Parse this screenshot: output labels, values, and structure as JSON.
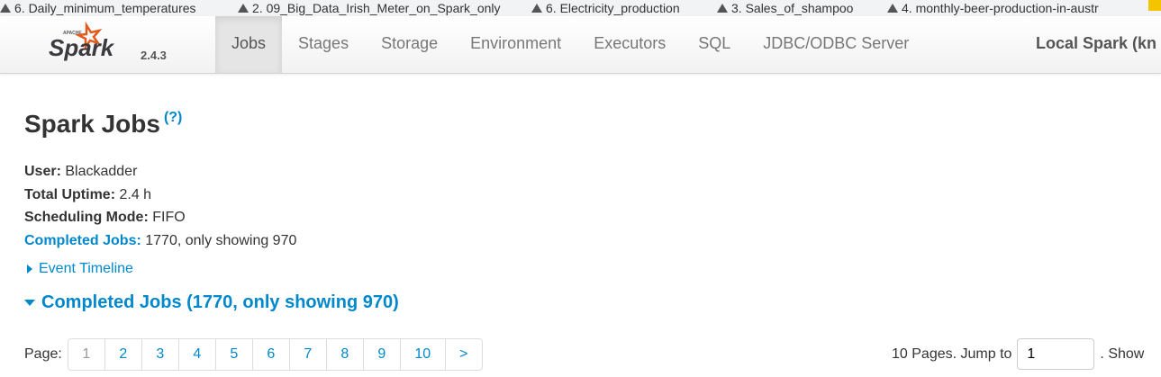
{
  "bookmarks": [
    "6. Daily_minimum_temperatures",
    "2. 09_Big_Data_Irish_Meter_on_Spark_only",
    "6. Electricity_production",
    "3. Sales_of_shampoo",
    "4. monthly-beer-production-in-austr"
  ],
  "navbar": {
    "logo_text": "Apache Spark",
    "version": "2.4.3",
    "tabs": [
      "Jobs",
      "Stages",
      "Storage",
      "Environment",
      "Executors",
      "SQL",
      "JDBC/ODBC Server"
    ],
    "active_tab": "Jobs",
    "app_name": "Local Spark (kn"
  },
  "page": {
    "title": "Spark Jobs",
    "help": "(?)",
    "info": [
      {
        "label": "User:",
        "value": "Blackadder"
      },
      {
        "label": "Total Uptime:",
        "value": "2.4 h"
      },
      {
        "label": "Scheduling Mode:",
        "value": "FIFO"
      },
      {
        "label": "Completed Jobs:",
        "value": "1770, only showing 970"
      }
    ],
    "event_timeline": "Event Timeline",
    "completed_header": "Completed Jobs (1770, only showing 970)"
  },
  "pagination": {
    "label": "Page:",
    "pages": [
      "1",
      "2",
      "3",
      "4",
      "5",
      "6",
      "7",
      "8",
      "9",
      "10"
    ],
    "next": ">",
    "current": "1",
    "summary": "10 Pages. Jump to",
    "jump_value": "1",
    "show": ". Show"
  }
}
